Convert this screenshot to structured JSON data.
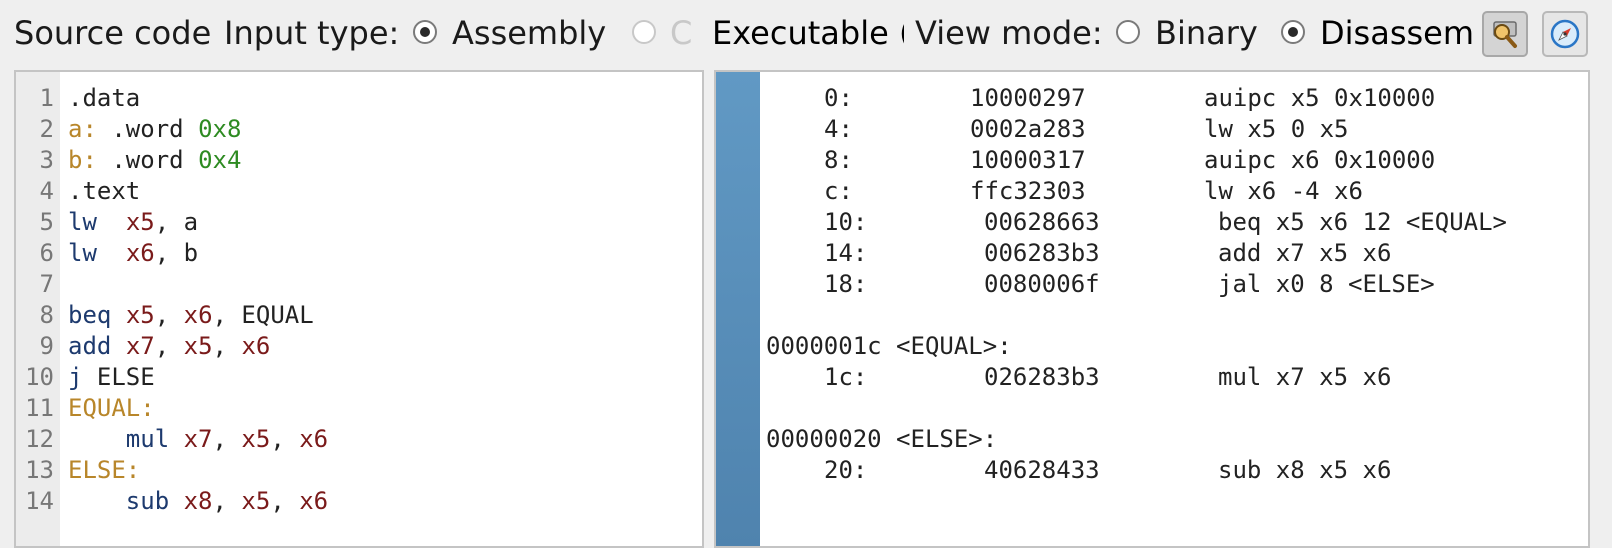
{
  "toolbar": {
    "source_code_label": "Source code",
    "input_type_label": "Input type:",
    "input_options": [
      {
        "label": "Assembly",
        "selected": true,
        "disabled": false
      },
      {
        "label": "C",
        "selected": false,
        "disabled": true
      },
      {
        "label": "Executable (",
        "selected": false,
        "disabled": false
      }
    ],
    "view_mode_label": "View mode:",
    "view_options": [
      {
        "label": "Binary",
        "selected": false
      },
      {
        "label": "Disassembly",
        "selected": true
      }
    ],
    "tool_icons": [
      "debug-icon",
      "compass-icon"
    ]
  },
  "editor": {
    "line_numbers": [
      "1",
      "2",
      "3",
      "4",
      "5",
      "6",
      "7",
      "8",
      "9",
      "10",
      "11",
      "12",
      "13",
      "14"
    ],
    "lines": [
      [
        {
          "t": ".data",
          "k": "plain"
        }
      ],
      [
        {
          "t": "a:",
          "k": "label"
        },
        {
          "t": " .word ",
          "k": "plain"
        },
        {
          "t": "0x8",
          "k": "num"
        }
      ],
      [
        {
          "t": "b:",
          "k": "label"
        },
        {
          "t": " .word ",
          "k": "plain"
        },
        {
          "t": "0x4",
          "k": "num"
        }
      ],
      [
        {
          "t": ".text",
          "k": "plain"
        }
      ],
      [
        {
          "t": "lw",
          "k": "kw"
        },
        {
          "t": "  ",
          "k": "plain"
        },
        {
          "t": "x5",
          "k": "reg"
        },
        {
          "t": ", a",
          "k": "plain"
        }
      ],
      [
        {
          "t": "lw",
          "k": "kw"
        },
        {
          "t": "  ",
          "k": "plain"
        },
        {
          "t": "x6",
          "k": "reg"
        },
        {
          "t": ", b",
          "k": "plain"
        }
      ],
      [],
      [
        {
          "t": "beq",
          "k": "kw"
        },
        {
          "t": " ",
          "k": "plain"
        },
        {
          "t": "x5",
          "k": "reg"
        },
        {
          "t": ", ",
          "k": "plain"
        },
        {
          "t": "x6",
          "k": "reg"
        },
        {
          "t": ", EQUAL",
          "k": "plain"
        }
      ],
      [
        {
          "t": "add",
          "k": "kw"
        },
        {
          "t": " ",
          "k": "plain"
        },
        {
          "t": "x7",
          "k": "reg"
        },
        {
          "t": ", ",
          "k": "plain"
        },
        {
          "t": "x5",
          "k": "reg"
        },
        {
          "t": ", ",
          "k": "plain"
        },
        {
          "t": "x6",
          "k": "reg"
        }
      ],
      [
        {
          "t": "j",
          "k": "kw"
        },
        {
          "t": " ELSE",
          "k": "plain"
        }
      ],
      [
        {
          "t": "EQUAL:",
          "k": "label"
        }
      ],
      [
        {
          "t": "    ",
          "k": "plain"
        },
        {
          "t": "mul",
          "k": "kw"
        },
        {
          "t": " ",
          "k": "plain"
        },
        {
          "t": "x7",
          "k": "reg"
        },
        {
          "t": ", ",
          "k": "plain"
        },
        {
          "t": "x5",
          "k": "reg"
        },
        {
          "t": ", ",
          "k": "plain"
        },
        {
          "t": "x6",
          "k": "reg"
        }
      ],
      [
        {
          "t": "ELSE:",
          "k": "label"
        }
      ],
      [
        {
          "t": "    ",
          "k": "plain"
        },
        {
          "t": "sub",
          "k": "kw"
        },
        {
          "t": " ",
          "k": "plain"
        },
        {
          "t": "x8",
          "k": "reg"
        },
        {
          "t": ", ",
          "k": "plain"
        },
        {
          "t": "x5",
          "k": "reg"
        },
        {
          "t": ", ",
          "k": "plain"
        },
        {
          "t": "x6",
          "k": "reg"
        }
      ]
    ]
  },
  "disassembly": {
    "rows": [
      {
        "kind": "instr",
        "addr": "0:",
        "hex": "10000297",
        "asm": "auipc x5 0x10000"
      },
      {
        "kind": "instr",
        "addr": "4:",
        "hex": "0002a283",
        "asm": "lw x5 0 x5"
      },
      {
        "kind": "instr",
        "addr": "8:",
        "hex": "10000317",
        "asm": "auipc x6 0x10000"
      },
      {
        "kind": "instr",
        "addr": "c:",
        "hex": "ffc32303",
        "asm": "lw x6 -4 x6"
      },
      {
        "kind": "instr",
        "addr": "10:",
        "hex": "00628663",
        "asm": "beq x5 x6 12 <EQUAL>"
      },
      {
        "kind": "instr",
        "addr": "14:",
        "hex": "006283b3",
        "asm": "add x7 x5 x6"
      },
      {
        "kind": "instr",
        "addr": "18:",
        "hex": "0080006f",
        "asm": "jal x0 8 <ELSE>"
      },
      {
        "kind": "blank"
      },
      {
        "kind": "label",
        "text": "0000001c <EQUAL>:"
      },
      {
        "kind": "instr",
        "addr": "1c:",
        "hex": "026283b3",
        "asm": "mul x7 x5 x6"
      },
      {
        "kind": "blank"
      },
      {
        "kind": "label",
        "text": "00000020 <ELSE>:"
      },
      {
        "kind": "instr",
        "addr": "20:",
        "hex": "40628433",
        "asm": "sub x8 x5 x6"
      }
    ]
  }
}
